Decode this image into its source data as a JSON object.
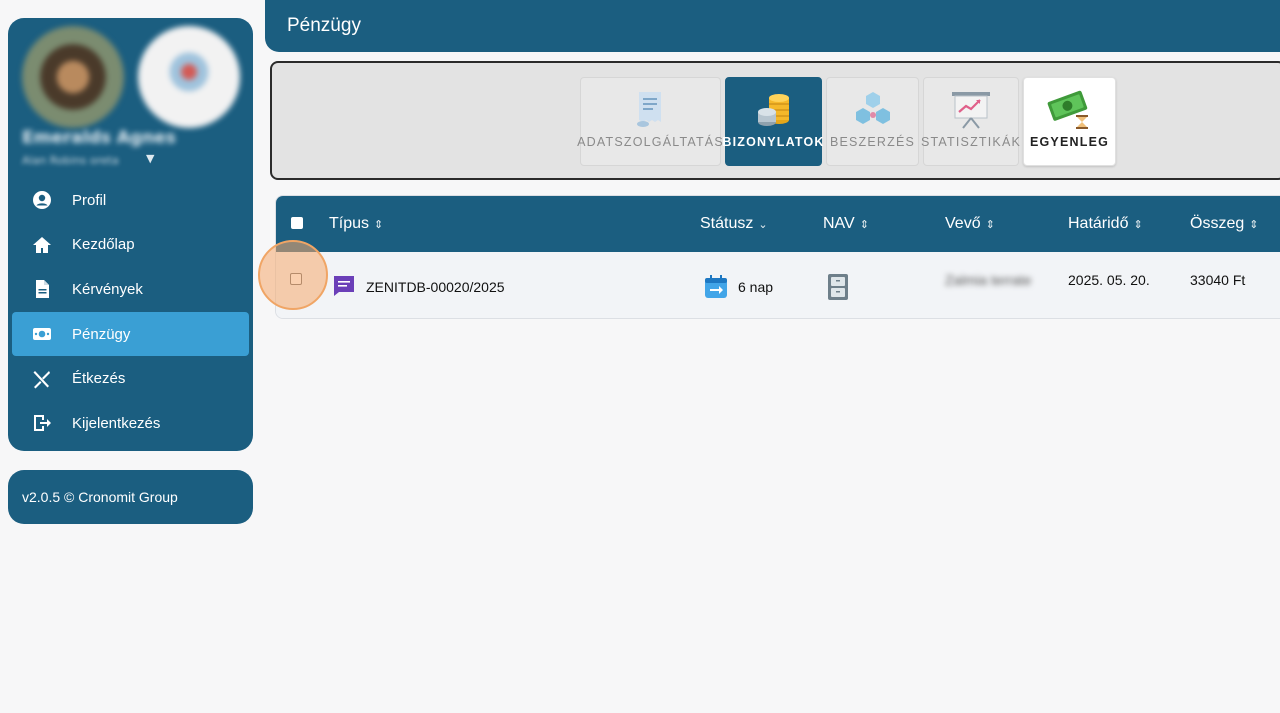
{
  "sidebar": {
    "user_name": "Emeralds Agnes",
    "user_sub": "Alan Robins oreta",
    "nav_items": [
      {
        "label": "Profil",
        "icon": "user-circle-icon"
      },
      {
        "label": "Kezdőlap",
        "icon": "home-icon"
      },
      {
        "label": "Kérvények",
        "icon": "document-icon"
      },
      {
        "label": "Pénzügy",
        "icon": "money-icon",
        "active": true
      },
      {
        "label": "Étkezés",
        "icon": "utensils-icon"
      },
      {
        "label": "Kijelentkezés",
        "icon": "logout-icon"
      }
    ],
    "version": "v2.0.5 © Cronomit Group"
  },
  "header": {
    "title": "Pénzügy"
  },
  "toolbar": {
    "tabs": [
      {
        "label": "ADATSZOLGÁLTATÁS",
        "icon": "receipt-icon"
      },
      {
        "label": "BIZONYLATOK",
        "icon": "coins-icon",
        "active": true
      },
      {
        "label": "BESZERZÉS",
        "icon": "cubes-icon"
      },
      {
        "label": "STATISZTIKÁK",
        "icon": "presentation-chart-icon"
      },
      {
        "label": "EGYENLEG",
        "icon": "cash-hourglass-icon"
      }
    ]
  },
  "table": {
    "columns": [
      "Típus",
      "Státusz",
      "NAV",
      "Vevő",
      "Határidő",
      "Összeg"
    ],
    "rows": [
      {
        "type": "ZENITDB-00020/2025",
        "status": "6 nap",
        "buyer": "Zalmia terrate",
        "deadline": "2025. 05. 20.",
        "amount": "33040 Ft"
      }
    ]
  },
  "colors": {
    "primary": "#1b5e80",
    "accent": "#3a9fd4",
    "highlight": "#f0a565"
  }
}
